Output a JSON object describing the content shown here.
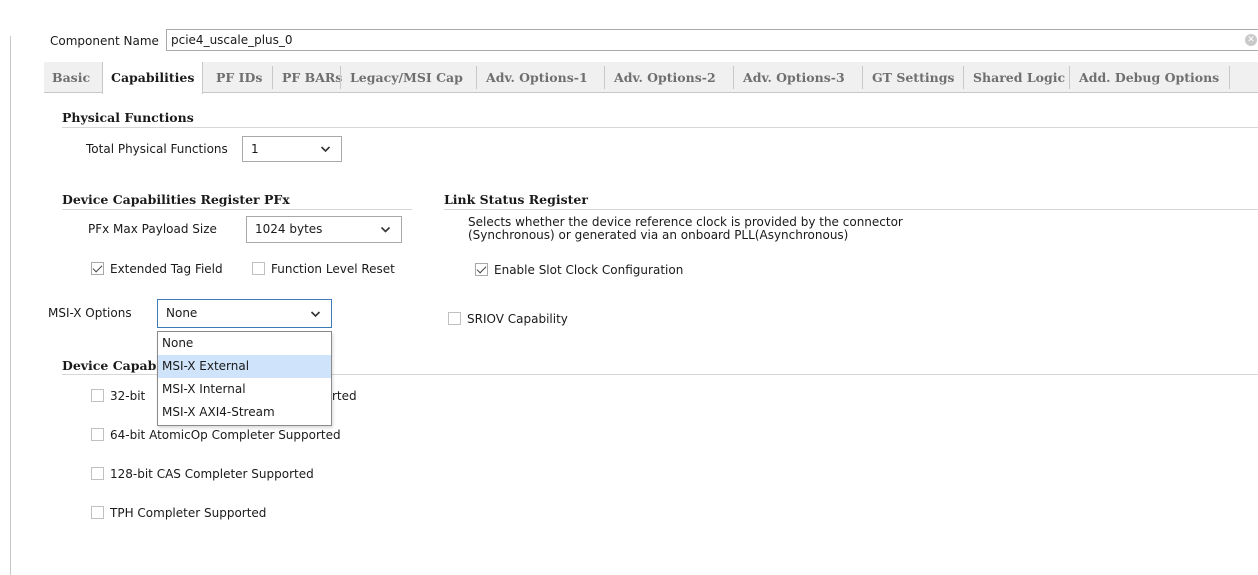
{
  "component": {
    "label": "Component Name",
    "value": "pcie4_uscale_plus_0"
  },
  "tabs": [
    {
      "label": "Basic"
    },
    {
      "label": "Capabilities"
    },
    {
      "label": "PF IDs"
    },
    {
      "label": "PF BARs"
    },
    {
      "label": "Legacy/MSI Cap"
    },
    {
      "label": "Adv. Options-1"
    },
    {
      "label": "Adv. Options-2"
    },
    {
      "label": "Adv. Options-3"
    },
    {
      "label": "GT Settings"
    },
    {
      "label": "Shared Logic"
    },
    {
      "label": "Add. Debug Options"
    }
  ],
  "active_tab": "Capabilities",
  "physical_functions": {
    "title": "Physical Functions",
    "total_label": "Total Physical Functions",
    "total_value": "1"
  },
  "device_caps": {
    "title": "Device Capabilities Register PFx",
    "payload_label": "PFx Max Payload Size",
    "payload_value": "1024 bytes",
    "extended_tag": {
      "label": "Extended Tag Field",
      "checked": true
    },
    "flr": {
      "label": "Function Level Reset",
      "checked": false
    },
    "msix_label": "MSI-X Options",
    "msix_value": "None"
  },
  "link_status": {
    "title": "Link Status Register",
    "desc_line1": "Selects whether the device reference clock is provided by the connector",
    "desc_line2": "(Synchronous) or generated via an onboard PLL(Asynchronous)",
    "slot_clock": {
      "label": "Enable Slot Clock Configuration",
      "checked": true
    },
    "sriov": {
      "label": "SRIOV Capability",
      "checked": false
    }
  },
  "device_caps2": {
    "title_visible": "Device Capabi",
    "items": [
      {
        "label_visible": "32-bit",
        "label_tail": "rted",
        "checked": false
      },
      {
        "label": "64-bit AtomicOp Completer Supported",
        "checked": false
      },
      {
        "label": "128-bit CAS Completer Supported",
        "checked": false
      },
      {
        "label": "TPH Completer Supported",
        "checked": false
      }
    ]
  },
  "msix_dropdown": {
    "options": [
      "None",
      "MSI-X External",
      "MSI-X Internal",
      "MSI-X AXI4-Stream"
    ],
    "highlighted": "MSI-X External"
  }
}
